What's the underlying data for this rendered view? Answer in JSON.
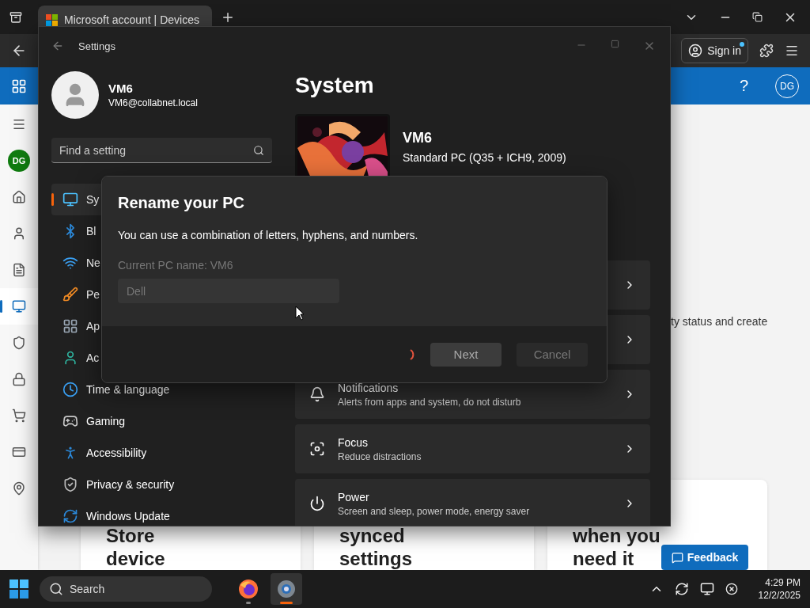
{
  "browser": {
    "tabs": [
      {
        "title": "Microsoft account | Devices",
        "selected": true
      }
    ],
    "sign_in": "Sign in",
    "help": "?",
    "avatar": "DG",
    "rail_avatar": "DG",
    "rail": [
      {
        "selected": false
      },
      {
        "selected": false
      },
      {
        "selected": false
      },
      {
        "selected": true
      },
      {
        "selected": false
      },
      {
        "selected": false
      },
      {
        "selected": false
      },
      {
        "selected": false
      },
      {
        "selected": false
      }
    ],
    "content": {
      "text": "ty status and create",
      "cards": [
        {
          "lines": [
            "Store",
            "device"
          ]
        },
        {
          "lines": [
            "synced",
            "settings"
          ]
        },
        {
          "lines": [
            "when you",
            "need it"
          ]
        }
      ],
      "feedback": "Feedback"
    }
  },
  "settings": {
    "title": "Settings",
    "user": {
      "name": "VM6",
      "email": "VM6@collabnet.local"
    },
    "search": {
      "placeholder": "Find a setting"
    },
    "nav": [
      {
        "label": "Sy",
        "selected": true
      },
      {
        "label": "Bl",
        "selected": false
      },
      {
        "label": "Ne",
        "selected": false
      },
      {
        "label": "Pe",
        "selected": false
      },
      {
        "label": "Ap",
        "selected": false
      },
      {
        "label": "Ac",
        "selected": false
      },
      {
        "label": "Time & language",
        "selected": false
      },
      {
        "label": "Gaming",
        "selected": false
      },
      {
        "label": "Accessibility",
        "selected": false
      },
      {
        "label": "Privacy & security",
        "selected": false
      },
      {
        "label": "Windows Update",
        "selected": false
      }
    ],
    "heading": "System",
    "device": {
      "name": "VM6",
      "model": "Standard PC (Q35 + ICH9, 2009)"
    },
    "cards": [
      {
        "kind": "covered"
      },
      {
        "kind": "covered"
      },
      {
        "kind": "item",
        "title": "Notifications",
        "subtitle": "Alerts from apps and system, do not disturb"
      },
      {
        "kind": "item",
        "title": "Focus",
        "subtitle": "Reduce distractions"
      },
      {
        "kind": "item",
        "title": "Power",
        "subtitle": "Screen and sleep, power mode, energy saver"
      }
    ]
  },
  "dialog": {
    "title": "Rename your PC",
    "text": "You can use a combination of letters, hyphens, and numbers.",
    "label": "Current PC name: VM6",
    "input": {
      "value": "Dell",
      "disabled": true
    },
    "busy": true,
    "buttons": [
      {
        "label": "Next",
        "kind": "primary"
      },
      {
        "label": "Cancel",
        "kind": "secondary"
      }
    ]
  },
  "taskbar": {
    "search": {
      "placeholder": "Search"
    },
    "apps": [
      {
        "selected": false
      },
      {
        "selected": true
      }
    ],
    "time": "4:29 PM",
    "date": "12/2/2025"
  }
}
